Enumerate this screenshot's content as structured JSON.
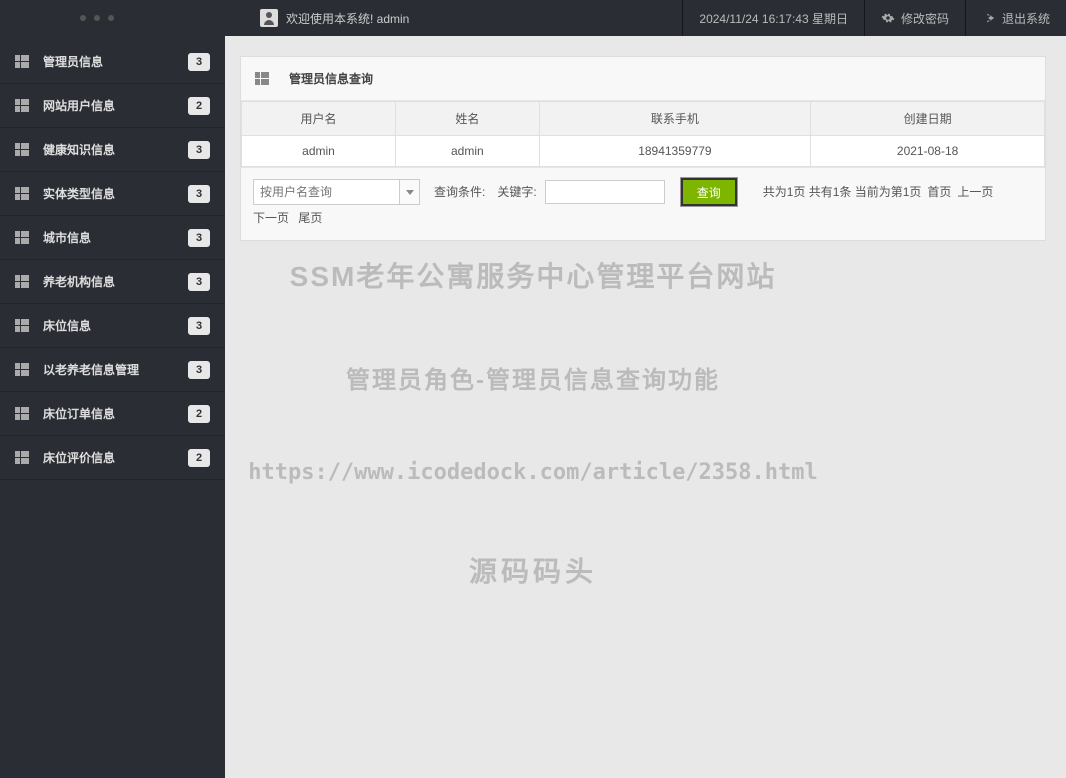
{
  "header": {
    "welcome": "欢迎使用本系统! admin",
    "datetime": "2024/11/24 16:17:43 星期日",
    "change_password": "修改密码",
    "logout": "退出系统"
  },
  "sidebar": {
    "items": [
      {
        "label": "管理员信息",
        "badge": "3"
      },
      {
        "label": "网站用户信息",
        "badge": "2"
      },
      {
        "label": "健康知识信息",
        "badge": "3"
      },
      {
        "label": "实体类型信息",
        "badge": "3"
      },
      {
        "label": "城市信息",
        "badge": "3"
      },
      {
        "label": "养老机构信息",
        "badge": "3"
      },
      {
        "label": "床位信息",
        "badge": "3"
      },
      {
        "label": "以老养老信息管理",
        "badge": "3"
      },
      {
        "label": "床位订单信息",
        "badge": "2"
      },
      {
        "label": "床位评价信息",
        "badge": "2"
      }
    ]
  },
  "panel": {
    "title": "管理员信息查询",
    "columns": [
      "用户名",
      "姓名",
      "联系手机",
      "创建日期"
    ],
    "rows": [
      {
        "username": "admin",
        "name": "admin",
        "phone": "18941359779",
        "date": "2021-08-18"
      }
    ],
    "search_placeholder": "按用户名查询",
    "cond_label": "查询条件:",
    "keyword_label": "关键字:",
    "keyword_value": "",
    "search_btn": "查询",
    "pager_summary": "共为1页  共有1条  当前为第1页",
    "pager_links": {
      "first": "首页",
      "prev": "上一页",
      "next": "下一页",
      "last": "尾页"
    }
  },
  "watermark": {
    "line1": "SSM老年公寓服务中心管理平台网站",
    "line2": "管理员角色-管理员信息查询功能",
    "line3": "https://www.icodedock.com/article/2358.html",
    "line4": "源码码头"
  }
}
